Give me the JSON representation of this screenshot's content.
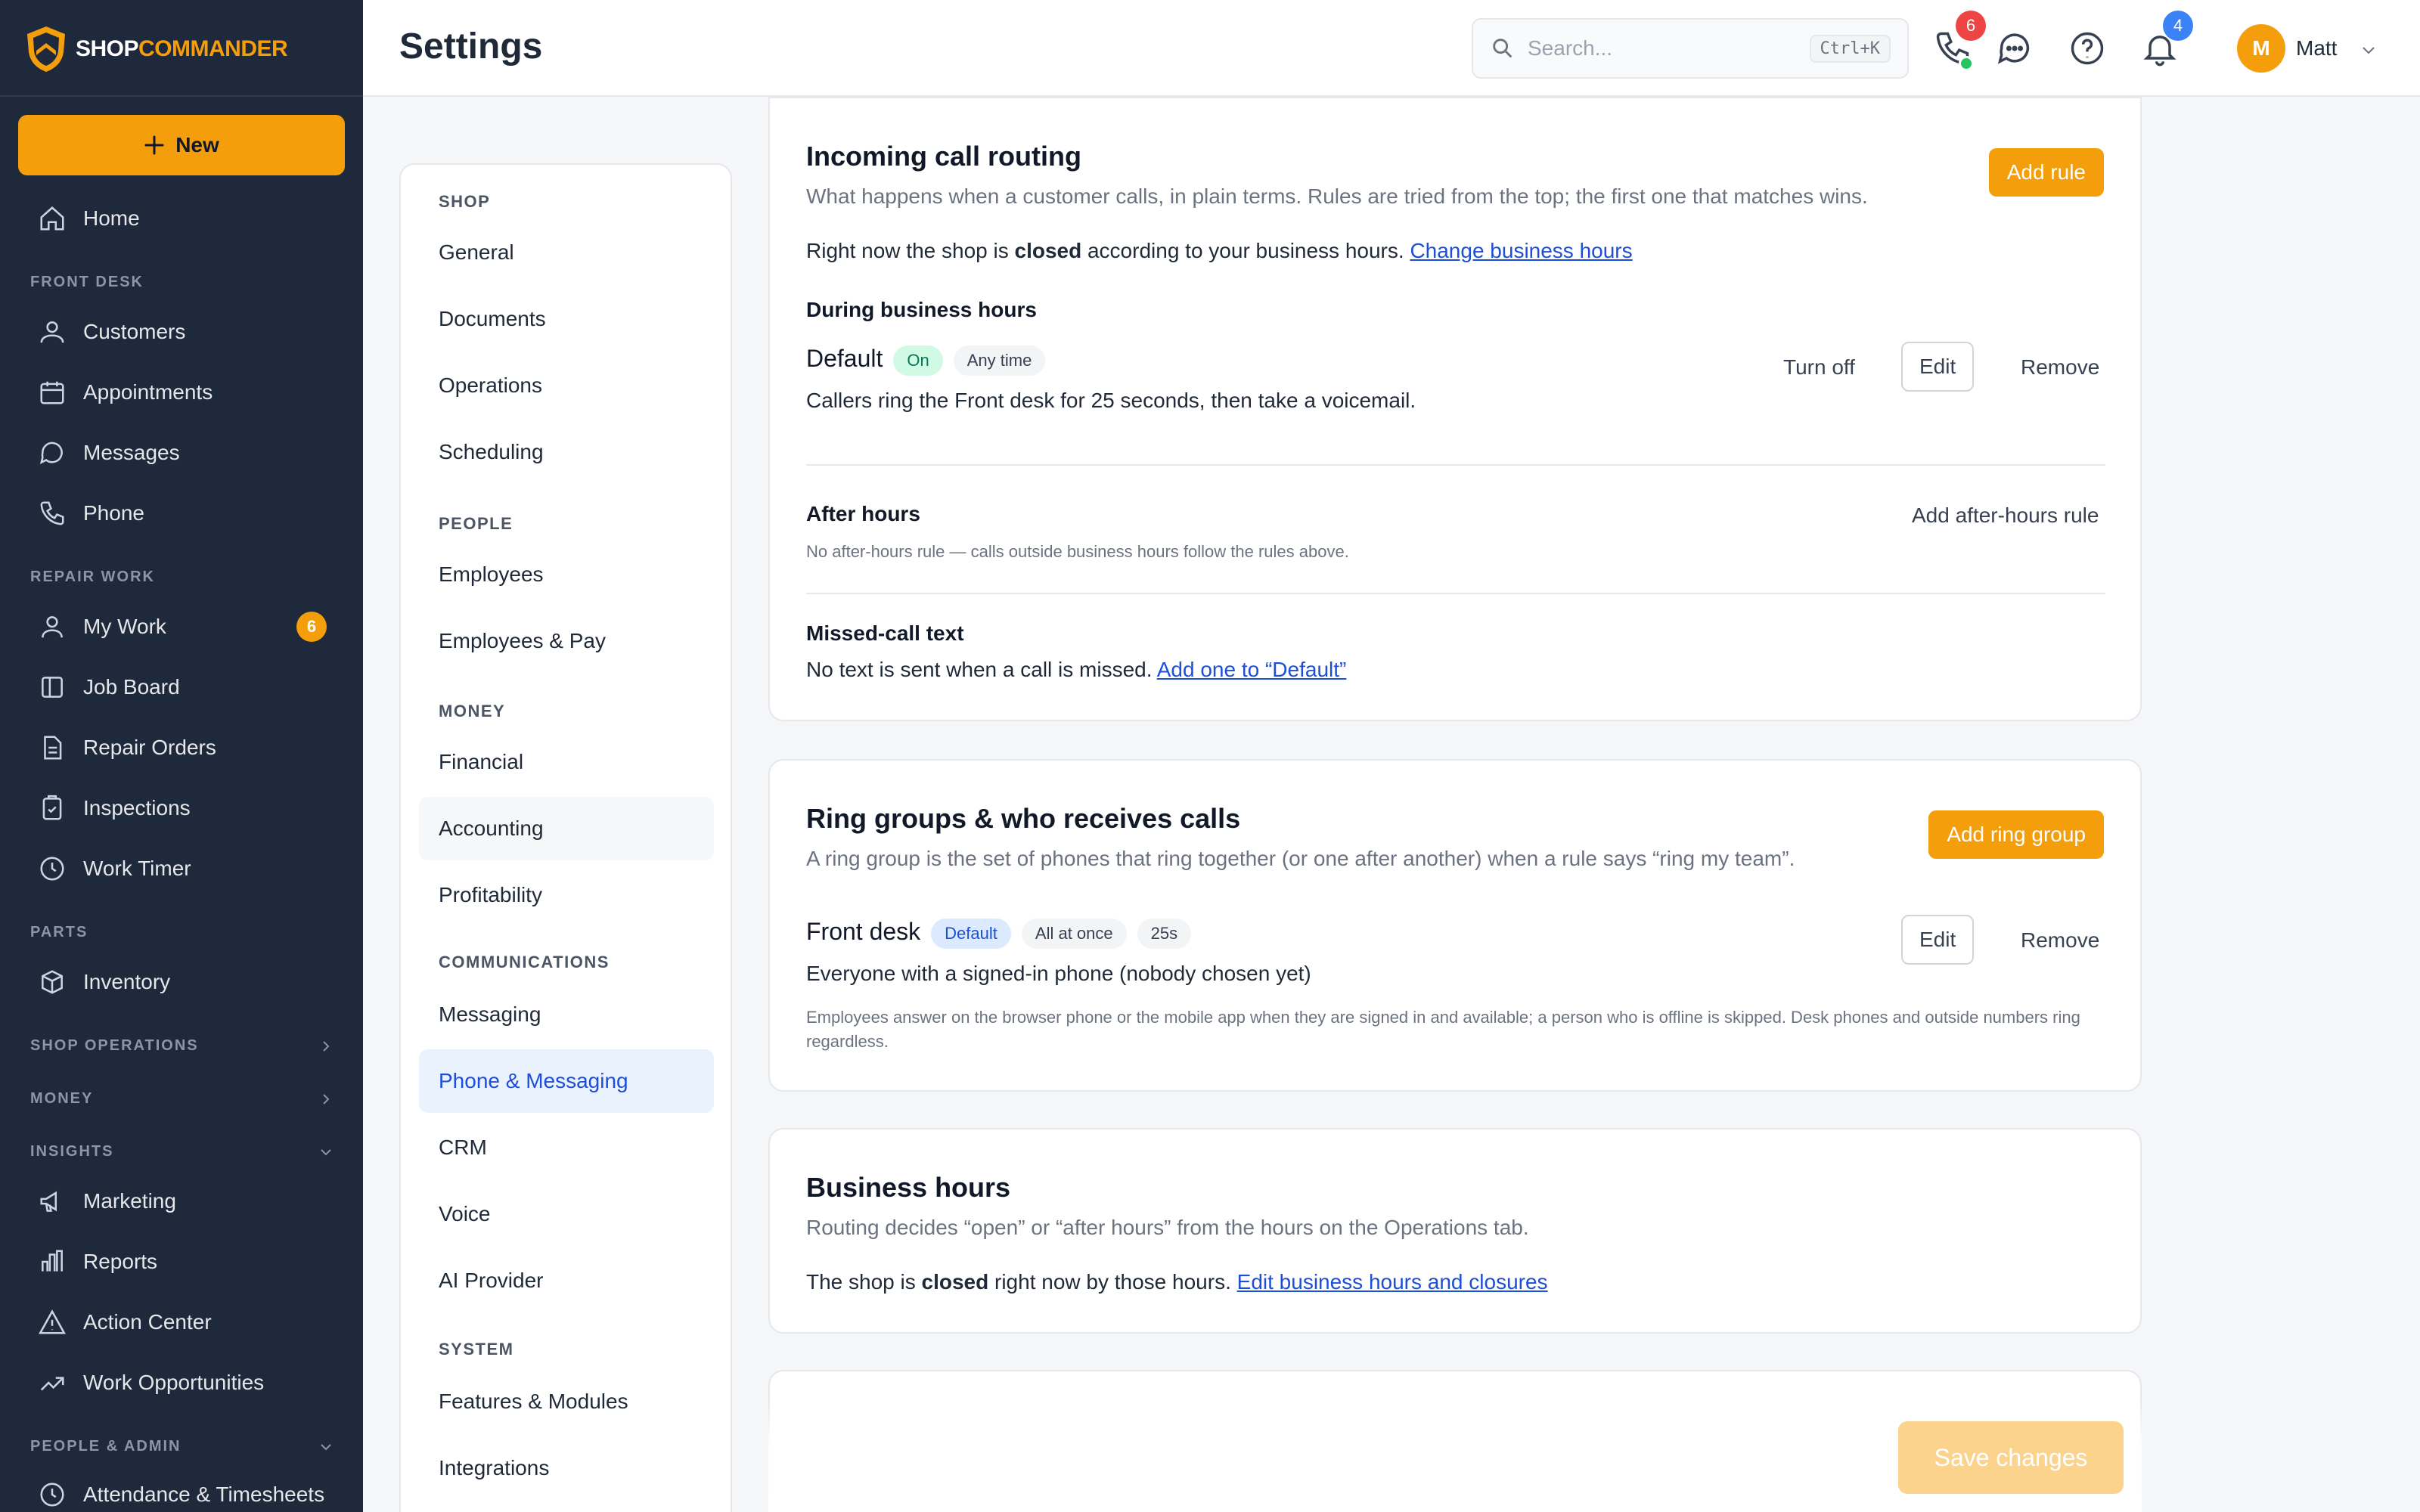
{
  "app": {
    "brand_a": "SHOP",
    "brand_b": "COMMANDER",
    "new_label": "New"
  },
  "sidebar": {
    "home": "Home",
    "sec_front": "FRONT DESK",
    "customers": "Customers",
    "appointments": "Appointments",
    "messages": "Messages",
    "phone": "Phone",
    "sec_repair": "REPAIR WORK",
    "mywork": "My Work",
    "mywork_badge": "6",
    "jobboard": "Job Board",
    "repairorders": "Repair Orders",
    "inspections": "Inspections",
    "worktimer": "Work Timer",
    "sec_parts": "PARTS",
    "inventory": "Inventory",
    "sec_shopops": "SHOP OPERATIONS",
    "sec_money": "MONEY",
    "sec_insights": "INSIGHTS",
    "marketing": "Marketing",
    "reports": "Reports",
    "actioncenter": "Action Center",
    "workopps": "Work Opportunities",
    "sec_people": "PEOPLE & ADMIN",
    "attendance": "Attendance & Timesheets"
  },
  "topbar": {
    "title": "Settings",
    "search_placeholder": "Search...",
    "search_shortcut": "Ctrl+K",
    "phone_badge": "6",
    "bell_badge": "4",
    "avatar_initial": "M",
    "user_name": "Matt"
  },
  "subnav": {
    "sec_shop": "SHOP",
    "general": "General",
    "documents": "Documents",
    "operations": "Operations",
    "scheduling": "Scheduling",
    "sec_people": "PEOPLE",
    "employees": "Employees",
    "employees_pay": "Employees & Pay",
    "sec_money": "MONEY",
    "financial": "Financial",
    "accounting": "Accounting",
    "profitability": "Profitability",
    "sec_comm": "COMMUNICATIONS",
    "messaging": "Messaging",
    "phone_messaging": "Phone & Messaging",
    "crm": "CRM",
    "voice": "Voice",
    "ai_provider": "AI Provider",
    "sec_system": "SYSTEM",
    "features": "Features & Modules",
    "integrations": "Integrations"
  },
  "routing": {
    "title": "Incoming call routing",
    "add_rule": "Add rule",
    "desc": "What happens when a customer calls, in plain terms. Rules are tried from the top; the first one that matches wins.",
    "status_a": "Right now the shop is ",
    "status_b": "closed",
    "status_c": " according to your business hours. ",
    "change_link": "Change business hours",
    "during": "During business hours",
    "rule_name": "Default",
    "rule_on": "On",
    "rule_time": "Any time",
    "rule_desc": "Callers ring the Front desk for 25 seconds, then take a voicemail.",
    "turn_off": "Turn off",
    "edit": "Edit",
    "remove": "Remove",
    "after_title": "After hours",
    "after_add": "Add after-hours rule",
    "after_desc": "No after-hours rule — calls outside business hours follow the rules above.",
    "missed_title": "Missed-call text",
    "missed_a": "No text is sent when a call is missed. ",
    "missed_link": "Add one to “Default”"
  },
  "ring": {
    "title": "Ring groups & who receives calls",
    "add": "Add ring group",
    "desc": "A ring group is the set of phones that ring together (or one after another) when a rule says “ring my team”.",
    "name": "Front desk",
    "p_default": "Default",
    "p_mode": "All at once",
    "p_time": "25s",
    "members": "Everyone with a signed-in phone (nobody chosen yet)",
    "edit": "Edit",
    "remove": "Remove",
    "note": "Employees answer on the browser phone or the mobile app when they are signed in and available; a person who is offline is skipped. Desk phones and outside numbers ring regardless."
  },
  "hours": {
    "title": "Business hours",
    "desc": "Routing decides “open” or “after hours” from the hours on the Operations tab.",
    "status_a": "The shop is ",
    "status_b": "closed",
    "status_c": " right now by those hours. ",
    "link": "Edit business hours and closures"
  },
  "footer": {
    "save": "Save changes"
  }
}
